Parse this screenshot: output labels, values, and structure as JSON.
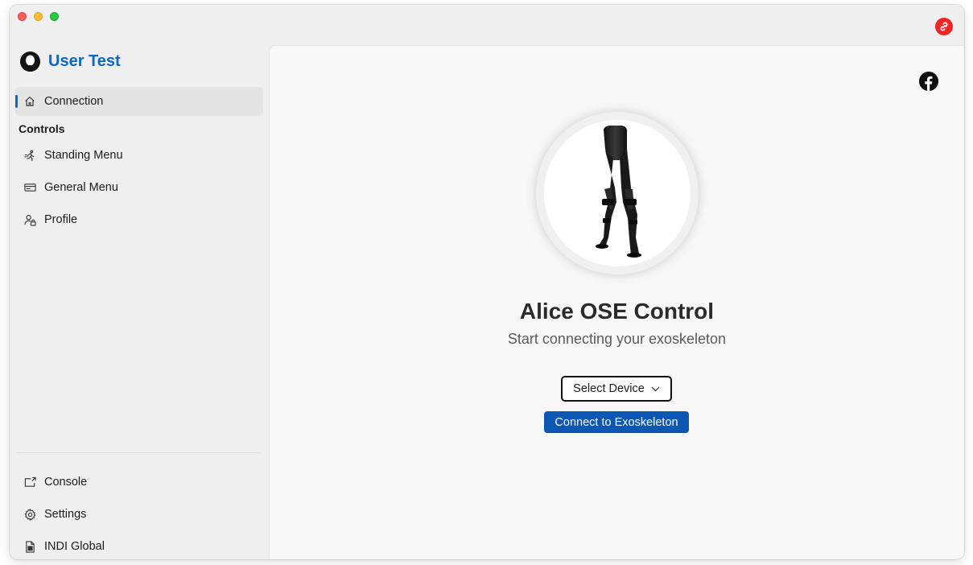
{
  "user": {
    "name": "User Test"
  },
  "sidebar": {
    "items": [
      {
        "label": "Connection",
        "icon": "home-icon"
      },
      {
        "label": "Standing Menu",
        "icon": "running-person-icon"
      },
      {
        "label": "General Menu",
        "icon": "card-icon"
      },
      {
        "label": "Profile",
        "icon": "person-lock-icon"
      }
    ],
    "section_controls": "Controls",
    "bottom_items": [
      {
        "label": "Console",
        "icon": "export-window-icon"
      },
      {
        "label": "Settings",
        "icon": "gear-icon"
      },
      {
        "label": "INDI Global",
        "icon": "document-icon"
      }
    ]
  },
  "main": {
    "title": "Alice OSE Control",
    "subtitle": "Start connecting your exoskeleton",
    "select_label": "Select Device",
    "connect_label": "Connect to Exoskeleton"
  },
  "colors": {
    "accent": "#0b66c8",
    "button": "#0c56b4",
    "link_badge": "#f22424"
  }
}
